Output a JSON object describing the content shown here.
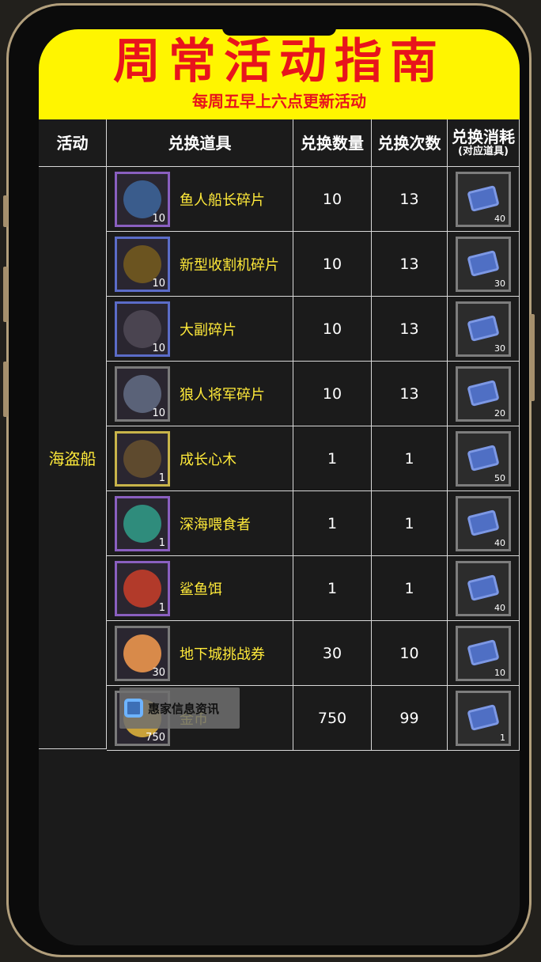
{
  "banner": {
    "title": "周常活动指南",
    "subtitle": "每周五早上六点更新活动"
  },
  "headers": {
    "activity": "活动",
    "item": "兑换道具",
    "quantity": "兑换数量",
    "times": "兑换次数",
    "cost": "兑换消耗",
    "cost_note": "(对应道具)"
  },
  "activity_name": "海盗船",
  "rows": [
    {
      "item": "鱼人船长碎片",
      "item_count": "10",
      "quantity": "10",
      "times": "13",
      "cost": "40",
      "icon": "fishman-captain-icon"
    },
    {
      "item": "新型收割机碎片",
      "item_count": "10",
      "quantity": "10",
      "times": "13",
      "cost": "30",
      "icon": "harvester-icon"
    },
    {
      "item": "大副碎片",
      "item_count": "10",
      "quantity": "10",
      "times": "13",
      "cost": "30",
      "icon": "first-mate-icon"
    },
    {
      "item": "狼人将军碎片",
      "item_count": "10",
      "quantity": "10",
      "times": "13",
      "cost": "20",
      "icon": "werewolf-general-icon"
    },
    {
      "item": "成长心木",
      "item_count": "1",
      "quantity": "1",
      "times": "1",
      "cost": "50",
      "icon": "heartwood-icon"
    },
    {
      "item": "深海喂食者",
      "item_count": "1",
      "quantity": "1",
      "times": "1",
      "cost": "40",
      "icon": "deep-sea-feeder-icon"
    },
    {
      "item": "鲨鱼饵",
      "item_count": "1",
      "quantity": "1",
      "times": "1",
      "cost": "40",
      "icon": "shark-bait-icon"
    },
    {
      "item": "地下城挑战券",
      "item_count": "30",
      "quantity": "30",
      "times": "10",
      "cost": "10",
      "icon": "dungeon-ticket-icon"
    },
    {
      "item": "金币",
      "item_count": "750",
      "quantity": "750",
      "times": "99",
      "cost": "1",
      "icon": "gold-coin-icon"
    }
  ],
  "watermark": "惠家信息资讯",
  "colors": {
    "banner_bg": "#fff500",
    "banner_text": "#e8141c",
    "item_text": "#ffea3a",
    "screen_bg": "#1b1b1b",
    "frame": "#b29f7c"
  }
}
